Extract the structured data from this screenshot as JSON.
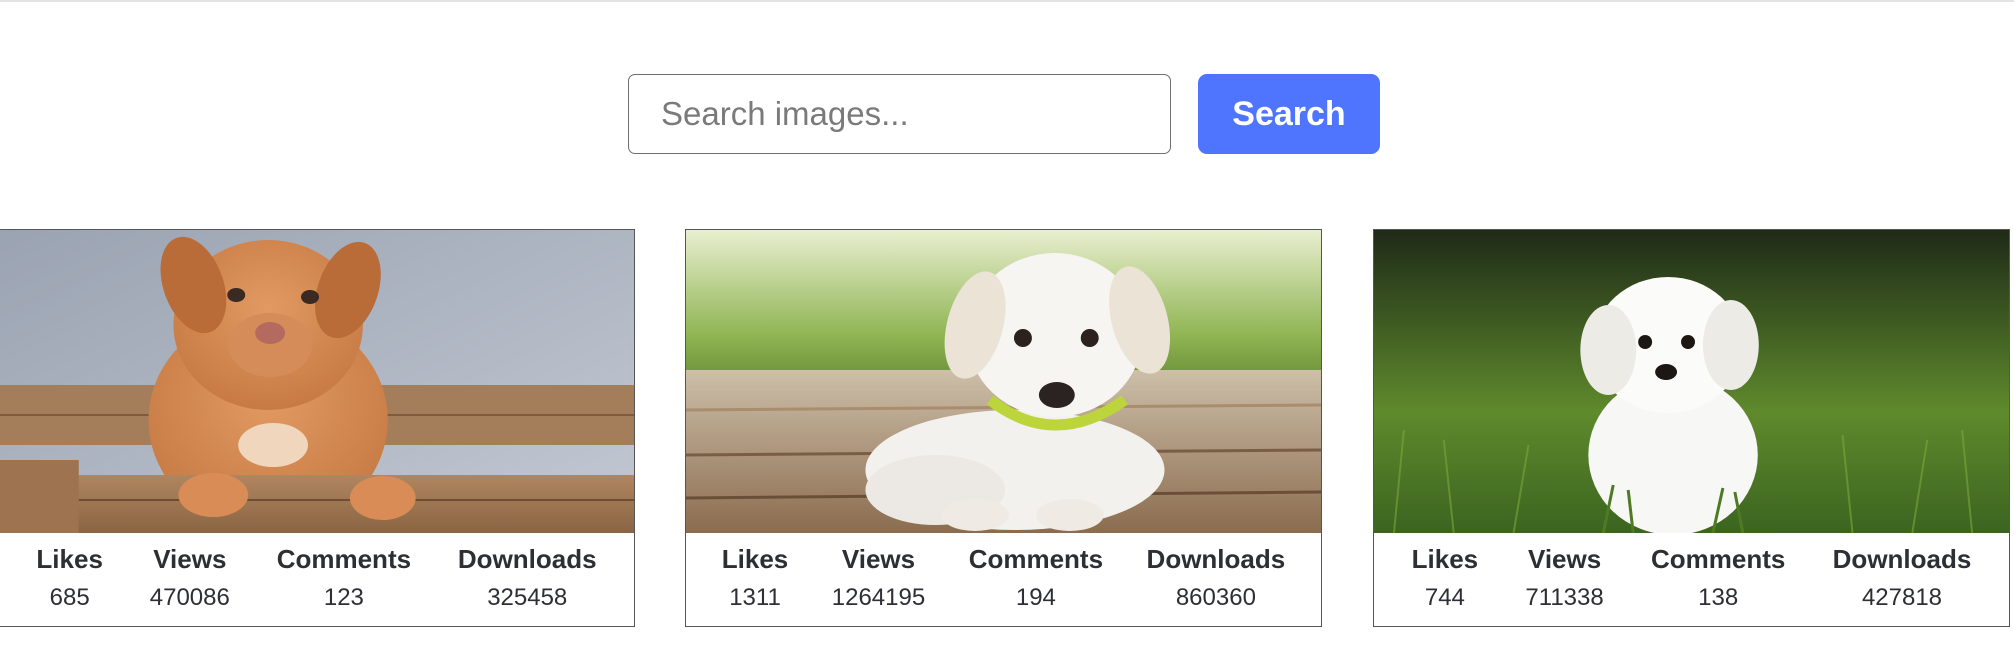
{
  "search": {
    "placeholder": "Search images...",
    "button_label": "Search",
    "accent_color": "#4f75ff"
  },
  "gallery": {
    "cards": [
      {
        "image_subject": "orange puppy in wooden crate",
        "stats": [
          {
            "label": "Likes",
            "value": "685"
          },
          {
            "label": "Views",
            "value": "470086"
          },
          {
            "label": "Comments",
            "value": "123"
          },
          {
            "label": "Downloads",
            "value": "325458"
          }
        ]
      },
      {
        "image_subject": "white puppy with green collar lying on wooden deck",
        "stats": [
          {
            "label": "Likes",
            "value": "1311"
          },
          {
            "label": "Views",
            "value": "1264195"
          },
          {
            "label": "Comments",
            "value": "194"
          },
          {
            "label": "Downloads",
            "value": "860360"
          }
        ]
      },
      {
        "image_subject": "white fluffy puppy sitting in grass",
        "stats": [
          {
            "label": "Likes",
            "value": "744"
          },
          {
            "label": "Views",
            "value": "711338"
          },
          {
            "label": "Comments",
            "value": "138"
          },
          {
            "label": "Downloads",
            "value": "427818"
          }
        ]
      }
    ]
  }
}
